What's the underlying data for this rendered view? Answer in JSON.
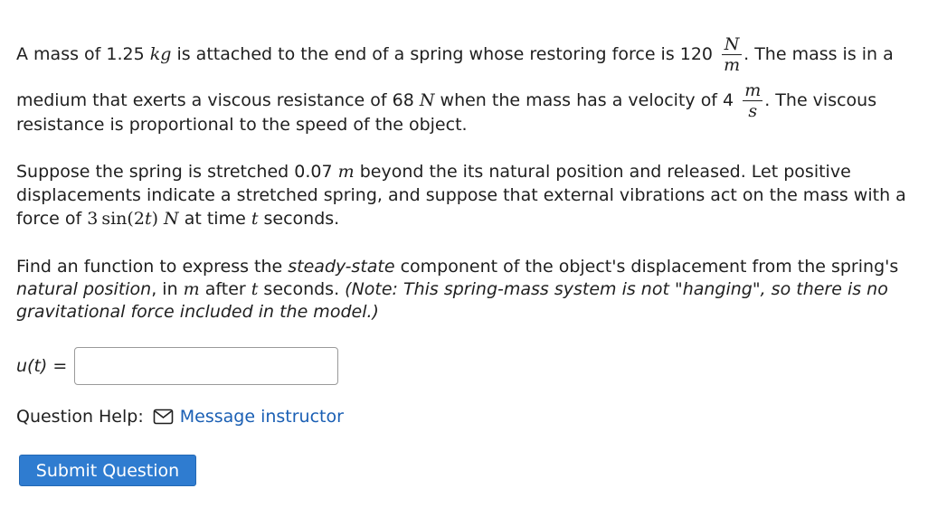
{
  "question": {
    "p1": {
      "l1_a": "A mass of 1.25 ",
      "l1_unit_kg": "kg",
      "l1_b": " is attached to the end of a spring whose restoring force is 120",
      "frac_N_num": "N",
      "frac_N_den": "m",
      "l1_c": ". The mass is in a",
      "l2_a": "medium that exerts a viscous resistance of 68 ",
      "l2_unit_N": "N",
      "l2_b": " when the mass has a velocity of 4",
      "frac_v_num": "m",
      "frac_v_den": "s",
      "l2_c": ". The viscous",
      "l3": "resistance is proportional to the speed of the object."
    },
    "p2": {
      "a": "Suppose the spring is stretched 0.07 ",
      "unit_m": "m",
      "b": " beyond the its natural position and released. Let positive displacements indicate a stretched spring, and suppose that external vibrations act on the mass with a force of ",
      "force_3": "3",
      "force_sin": "sin",
      "force_arg_open": "(2",
      "force_t": "t",
      "force_arg_close": ")",
      "force_N": " N",
      "c": " at time ",
      "t": "t",
      "d": " seconds."
    },
    "p3": {
      "a": "Find an function to express the ",
      "steady": "steady-state",
      "b": " component of the object's displacement from the spring's ",
      "natural": "natural position",
      "c": ", in ",
      "m": "m",
      "d": " after ",
      "t": "t",
      "e": " seconds. ",
      "note": "(Note: This spring-mass system is not \"hanging\", so there is no gravitational force included in the model.)"
    }
  },
  "answer": {
    "label": "u(t) =",
    "value": "",
    "placeholder": ""
  },
  "help": {
    "label": "Question Help:",
    "icon": "mail-icon",
    "link_text": "Message instructor",
    "link_color": "#1a5fb4"
  },
  "submit": {
    "label": "Submit Question",
    "bg_color": "#2f7cd0"
  }
}
